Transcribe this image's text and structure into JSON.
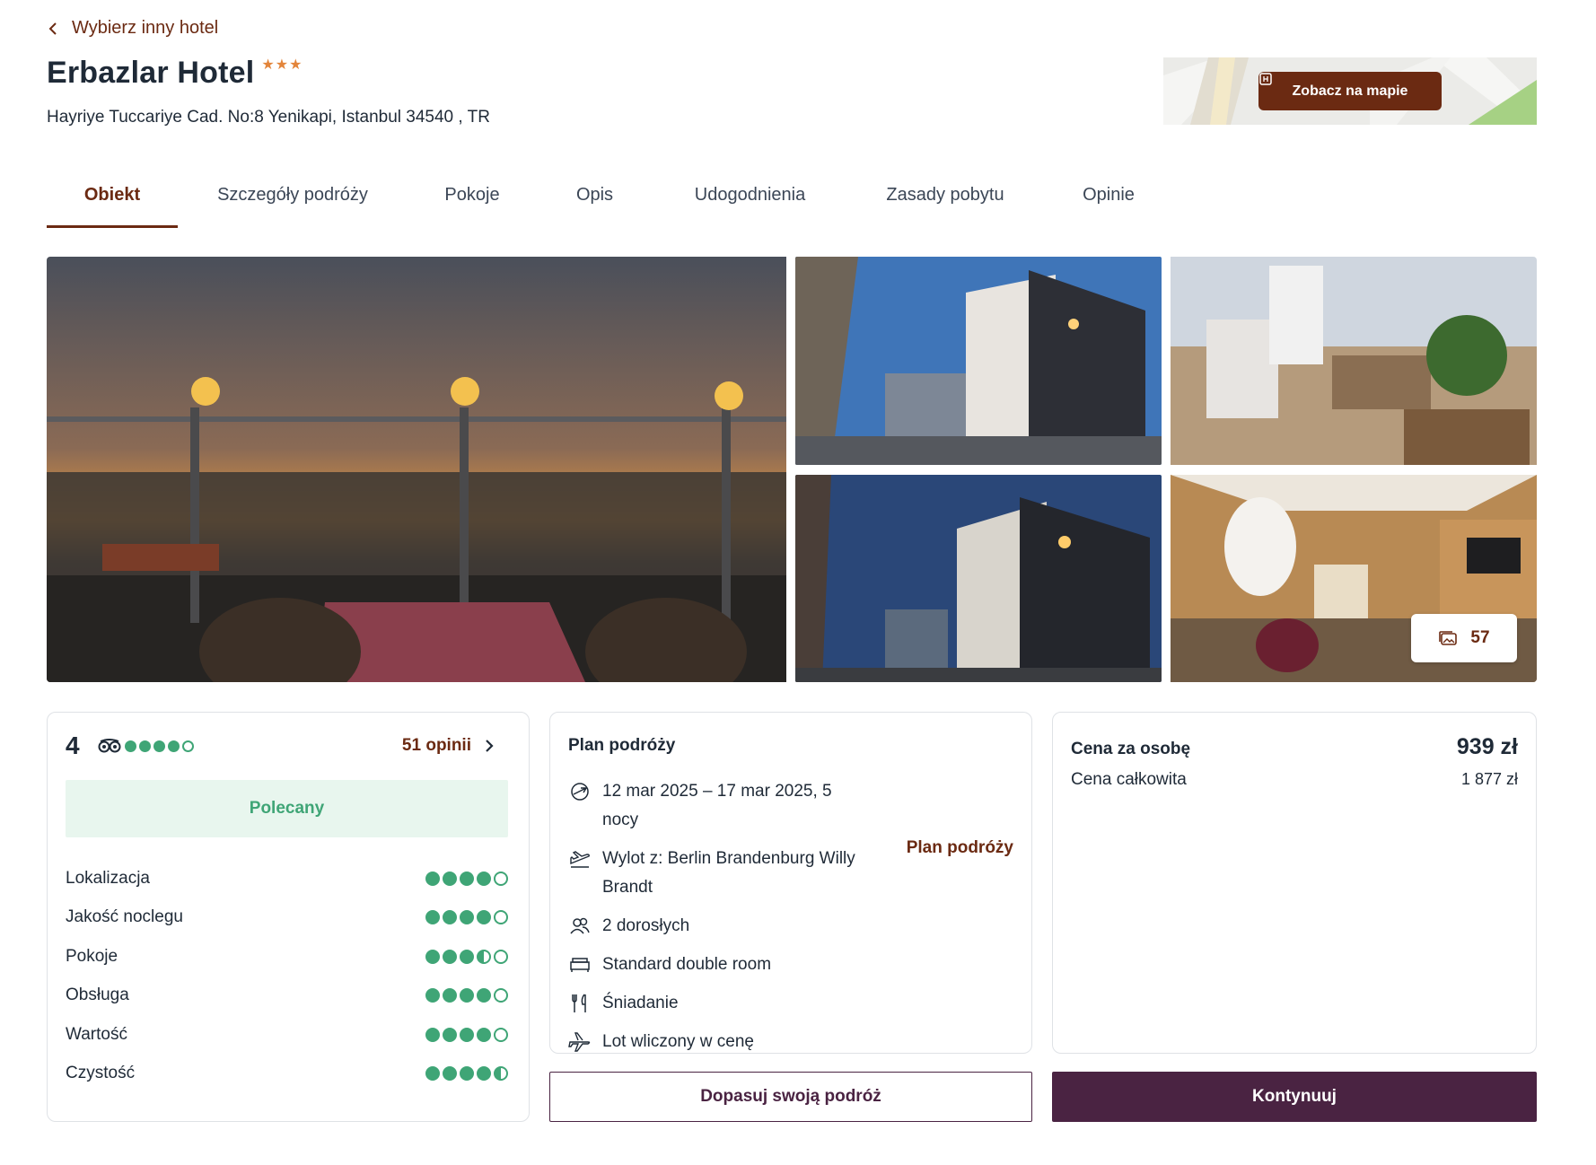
{
  "header": {
    "back_label": "Wybierz inny hotel",
    "hotel_name": "Erbazlar Hotel",
    "stars": "★★★",
    "address": "Hayriye Tuccariye Cad. No:8 Yenikapi, Istanbul 34540 , TR",
    "map_button_label": "Zobacz na mapie"
  },
  "tabs": [
    {
      "label": "Obiekt",
      "active": true
    },
    {
      "label": "Szczegóły podróży",
      "active": false
    },
    {
      "label": "Pokoje",
      "active": false
    },
    {
      "label": "Opis",
      "active": false
    },
    {
      "label": "Udogodnienia",
      "active": false
    },
    {
      "label": "Zasady pobytu",
      "active": false
    },
    {
      "label": "Opinie",
      "active": false
    }
  ],
  "gallery": {
    "photo_count": "57"
  },
  "rating": {
    "score": "4",
    "overall_dots": 4,
    "reviews_label": "51 opinii",
    "badge": "Polecany",
    "criteria": [
      {
        "label": "Lokalizacja",
        "value": 4
      },
      {
        "label": "Jakość noclegu",
        "value": 4
      },
      {
        "label": "Pokoje",
        "value": 3.5
      },
      {
        "label": "Obsługa",
        "value": 4
      },
      {
        "label": "Wartość",
        "value": 4
      },
      {
        "label": "Czystość",
        "value": 4.5
      }
    ]
  },
  "plan": {
    "title": "Plan podróży",
    "dates": "12 mar 2025 – 17 mar 2025, 5 nocy",
    "departure": "Wylot z: Berlin Brandenburg Willy Brandt",
    "guests": "2 dorosłych",
    "room": "Standard double room",
    "board": "Śniadanie",
    "flight": "Lot wliczony w cenę",
    "link_label": "Plan podróży"
  },
  "price": {
    "per_person_label": "Cena za osobę",
    "per_person_value": "939 zł",
    "total_label": "Cena całkowita",
    "total_value": "1 877 zł"
  },
  "actions": {
    "customize_label": "Dopasuj swoją podróż",
    "continue_label": "Kontynuuj"
  },
  "colors": {
    "brand": "#6b2a12",
    "primary_button": "#4a2342",
    "rating_green": "#3fa576",
    "star": "#e3853b"
  }
}
